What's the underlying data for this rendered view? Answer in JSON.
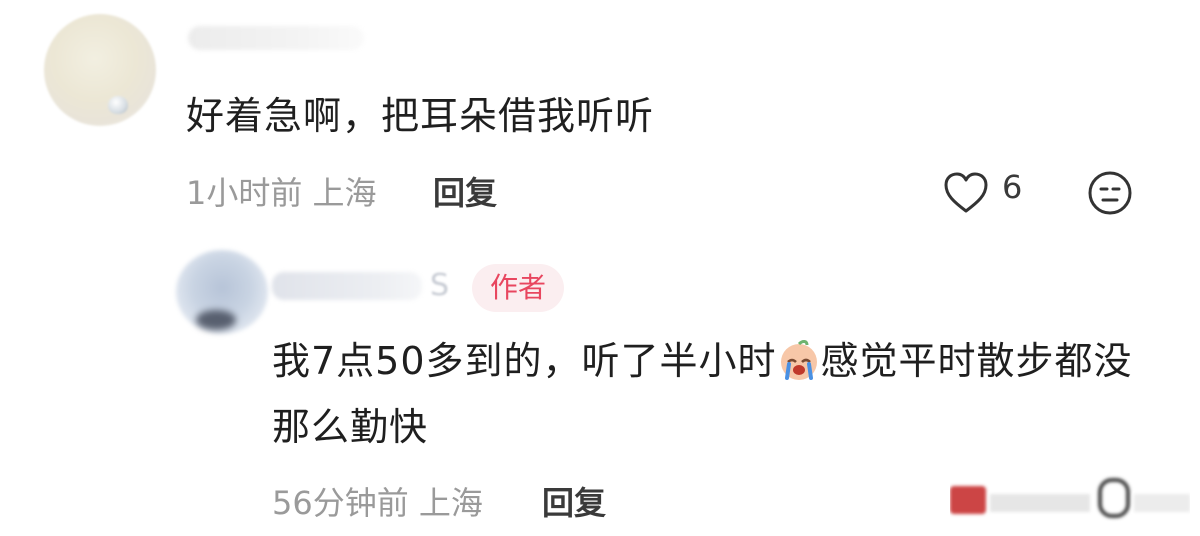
{
  "comment": {
    "text": "好着急啊，把耳朵借我听听",
    "time_location": "1小时前 上海",
    "reply_label": "回复",
    "like_count": "6",
    "icons": [
      "heart-icon",
      "dislike-face-icon"
    ]
  },
  "reply": {
    "author_badge": "作者",
    "name_visible_tail": "S",
    "text_before_emoji": "我7点50多到的，听了半小时",
    "text_after_emoji": "感觉平时散步都没那么勤快",
    "emoji": "crying-face-emoji",
    "time_location": "56分钟前 上海",
    "reply_label": "回复"
  },
  "colors": {
    "badge_bg": "#fbeef0",
    "badge_text": "#e8465f",
    "meta_gray": "#9a9a9a"
  }
}
